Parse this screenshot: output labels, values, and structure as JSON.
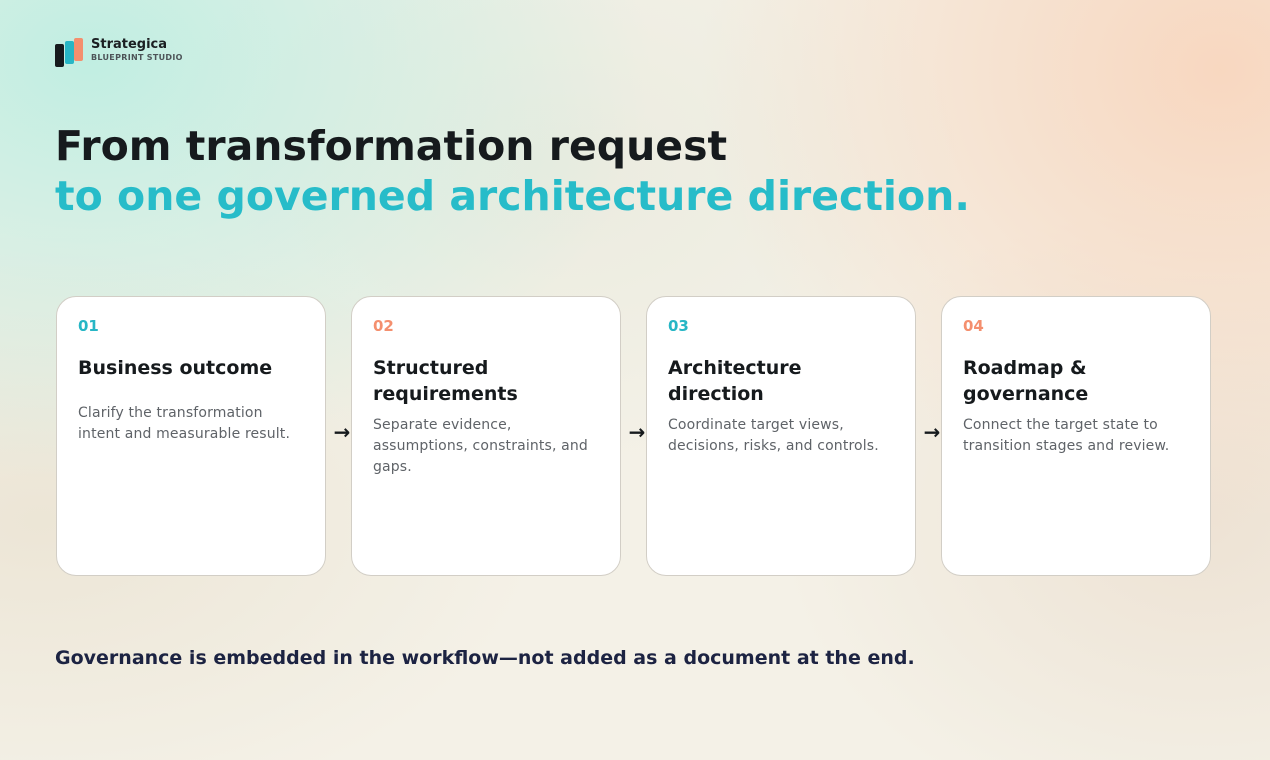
{
  "brand": {
    "name": "Strategica",
    "subtitle": "BLUEPRINT STUDIO",
    "icon": "logo-bars-icon",
    "colors": [
      "#161a1d",
      "#27b6c5",
      "#f48f6e"
    ]
  },
  "headline": {
    "line1": "From transformation request",
    "line2": "to one governed architecture direction."
  },
  "steps": [
    {
      "number": "01",
      "title": "Business outcome",
      "description": "Clarify the transformation intent and measurable result.",
      "accent": "#27b6c5"
    },
    {
      "number": "02",
      "title": "Structured requirements",
      "description": "Separate evidence, assumptions, constraints, and gaps.",
      "accent": "#f48f6e"
    },
    {
      "number": "03",
      "title": "Architecture direction",
      "description": "Coordinate target views, decisions, risks, and controls.",
      "accent": "#27b6c5"
    },
    {
      "number": "04",
      "title": "Roadmap & governance",
      "description": "Connect the target state to transition stages and review.",
      "accent": "#f48f6e"
    }
  ],
  "connector": "→",
  "tagline": "Governance is embedded in the workflow—not added as a document at the end."
}
